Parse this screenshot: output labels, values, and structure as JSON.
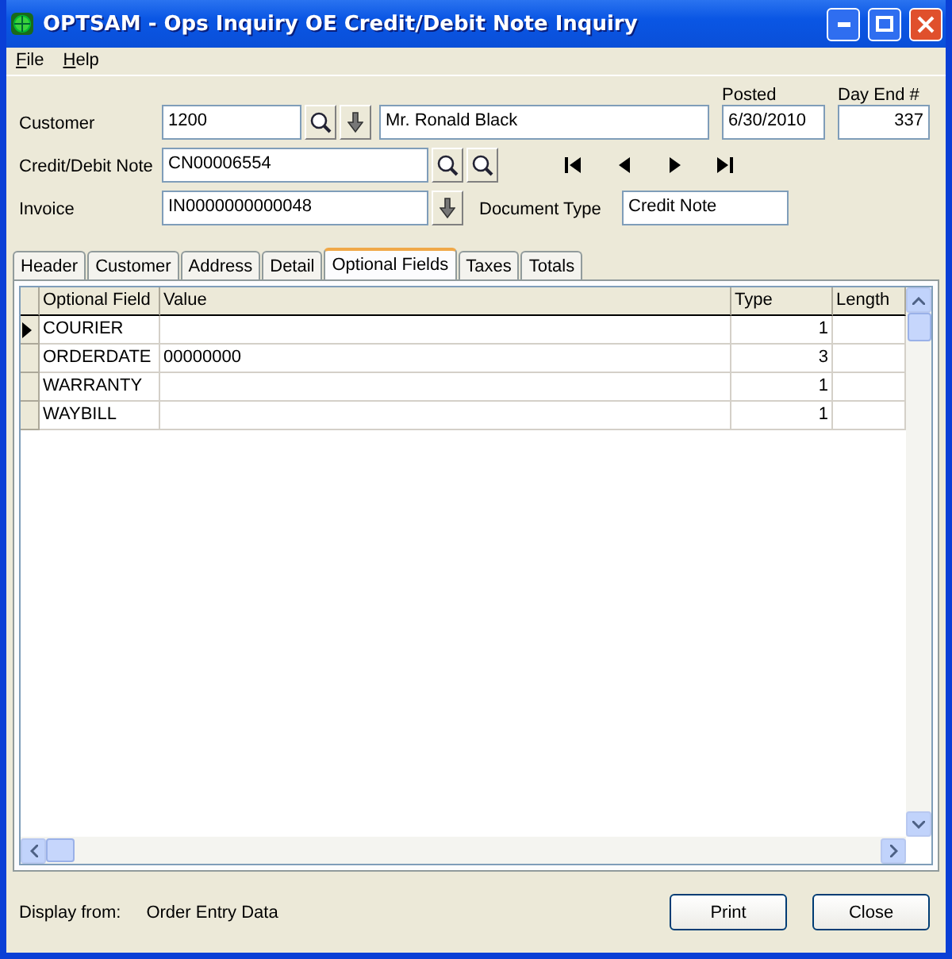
{
  "window": {
    "title": "OPTSAM - Ops Inquiry OE Credit/Debit Note Inquiry"
  },
  "menu": [
    "File",
    "Help"
  ],
  "form": {
    "customer_label": "Customer",
    "customer": "1200",
    "customer_name": "Mr. Ronald Black",
    "posted_label": "Posted",
    "posted": "6/30/2010",
    "day_end_label": "Day End #",
    "day_end": "337",
    "note_label": "Credit/Debit Note",
    "note": "CN00006554",
    "invoice_label": "Invoice",
    "invoice": "IN0000000000048",
    "document_type_label": "Document Type",
    "document_type": "Credit Note"
  },
  "tabs": [
    {
      "label": "Header",
      "selected": false
    },
    {
      "label": "Customer",
      "selected": false
    },
    {
      "label": "Address",
      "selected": false
    },
    {
      "label": "Detail",
      "selected": false
    },
    {
      "label": "Optional Fields",
      "selected": true
    },
    {
      "label": "Taxes",
      "selected": false
    },
    {
      "label": "Totals",
      "selected": false
    }
  ],
  "table": {
    "columns": [
      "Optional Field",
      "Value",
      "Type",
      "Length"
    ],
    "rows": [
      {
        "cells": [
          "COURIER",
          "",
          "1"
        ],
        "selected": true
      },
      {
        "cells": [
          "ORDERDATE",
          "00000000",
          "3"
        ],
        "selected": false
      },
      {
        "cells": [
          "WARRANTY",
          "",
          "1"
        ],
        "selected": false
      },
      {
        "cells": [
          "WAYBILL",
          "",
          "1"
        ],
        "selected": false
      }
    ]
  },
  "footer": {
    "label": "Display from:",
    "source": "Order Entry Data"
  },
  "buttons": [
    "Print",
    "Close"
  ]
}
